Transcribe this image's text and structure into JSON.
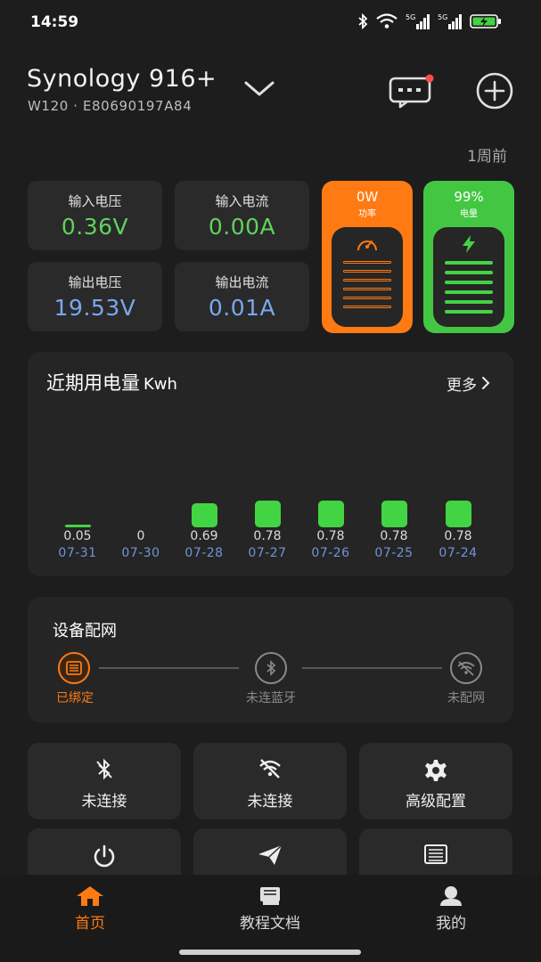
{
  "status_bar": {
    "time": "14:59",
    "battery_level": "charging"
  },
  "device": {
    "name": "Synology 916+",
    "subtitle": "W120 · E80690197A84",
    "updated": "1周前"
  },
  "metrics": [
    {
      "label": "输入电压",
      "value": "0.36V"
    },
    {
      "label": "输入电流",
      "value": "0.00A"
    },
    {
      "label": "输出电压",
      "value": "19.53V"
    },
    {
      "label": "输出电流",
      "value": "0.01A"
    }
  ],
  "power_card": {
    "value": "0W",
    "label": "功率",
    "color": "#ff7a12"
  },
  "battery_card": {
    "value": "99%",
    "label": "电量",
    "color": "#43c743",
    "level": 0.99
  },
  "usage": {
    "title": "近期用电量",
    "unit": "Kwh",
    "more_label": "更多"
  },
  "chart_data": {
    "type": "bar",
    "categories": [
      "07-31",
      "07-30",
      "07-28",
      "07-27",
      "07-26",
      "07-25",
      "07-24"
    ],
    "values": [
      0.05,
      0,
      0.69,
      0.78,
      0.78,
      0.78,
      0.78
    ],
    "value_labels": [
      "0.05",
      "0",
      "0.69",
      "0.78",
      "0.78",
      "0.78",
      "0.78"
    ],
    "title": "近期用电量",
    "ylabel": "Kwh",
    "ylim": [
      0,
      1
    ],
    "color": "#43d443"
  },
  "network": {
    "title": "设备配网",
    "steps": [
      {
        "label": "已绑定",
        "icon": "device-icon"
      },
      {
        "label": "未连蓝牙",
        "icon": "bluetooth-icon"
      },
      {
        "label": "未配网",
        "icon": "wifi-off-icon"
      }
    ]
  },
  "tiles": [
    {
      "label": "未连接",
      "icon": "bluetooth-off-icon"
    },
    {
      "label": "未连接",
      "icon": "wifi-off-icon"
    },
    {
      "label": "高级配置",
      "icon": "gear-icon"
    },
    {
      "label": "",
      "icon": "power-icon"
    },
    {
      "label": "",
      "icon": "send-icon"
    },
    {
      "label": "",
      "icon": "list-icon"
    }
  ],
  "tabs": [
    {
      "label": "首页",
      "icon": "home-icon",
      "active": true
    },
    {
      "label": "教程文档",
      "icon": "book-icon",
      "active": false
    },
    {
      "label": "我的",
      "icon": "user-icon",
      "active": false
    }
  ],
  "colors": {
    "accent": "#ff7a12",
    "green": "#43d443",
    "blue_value": "#7aa7ef",
    "background": "#1d1d1d"
  }
}
